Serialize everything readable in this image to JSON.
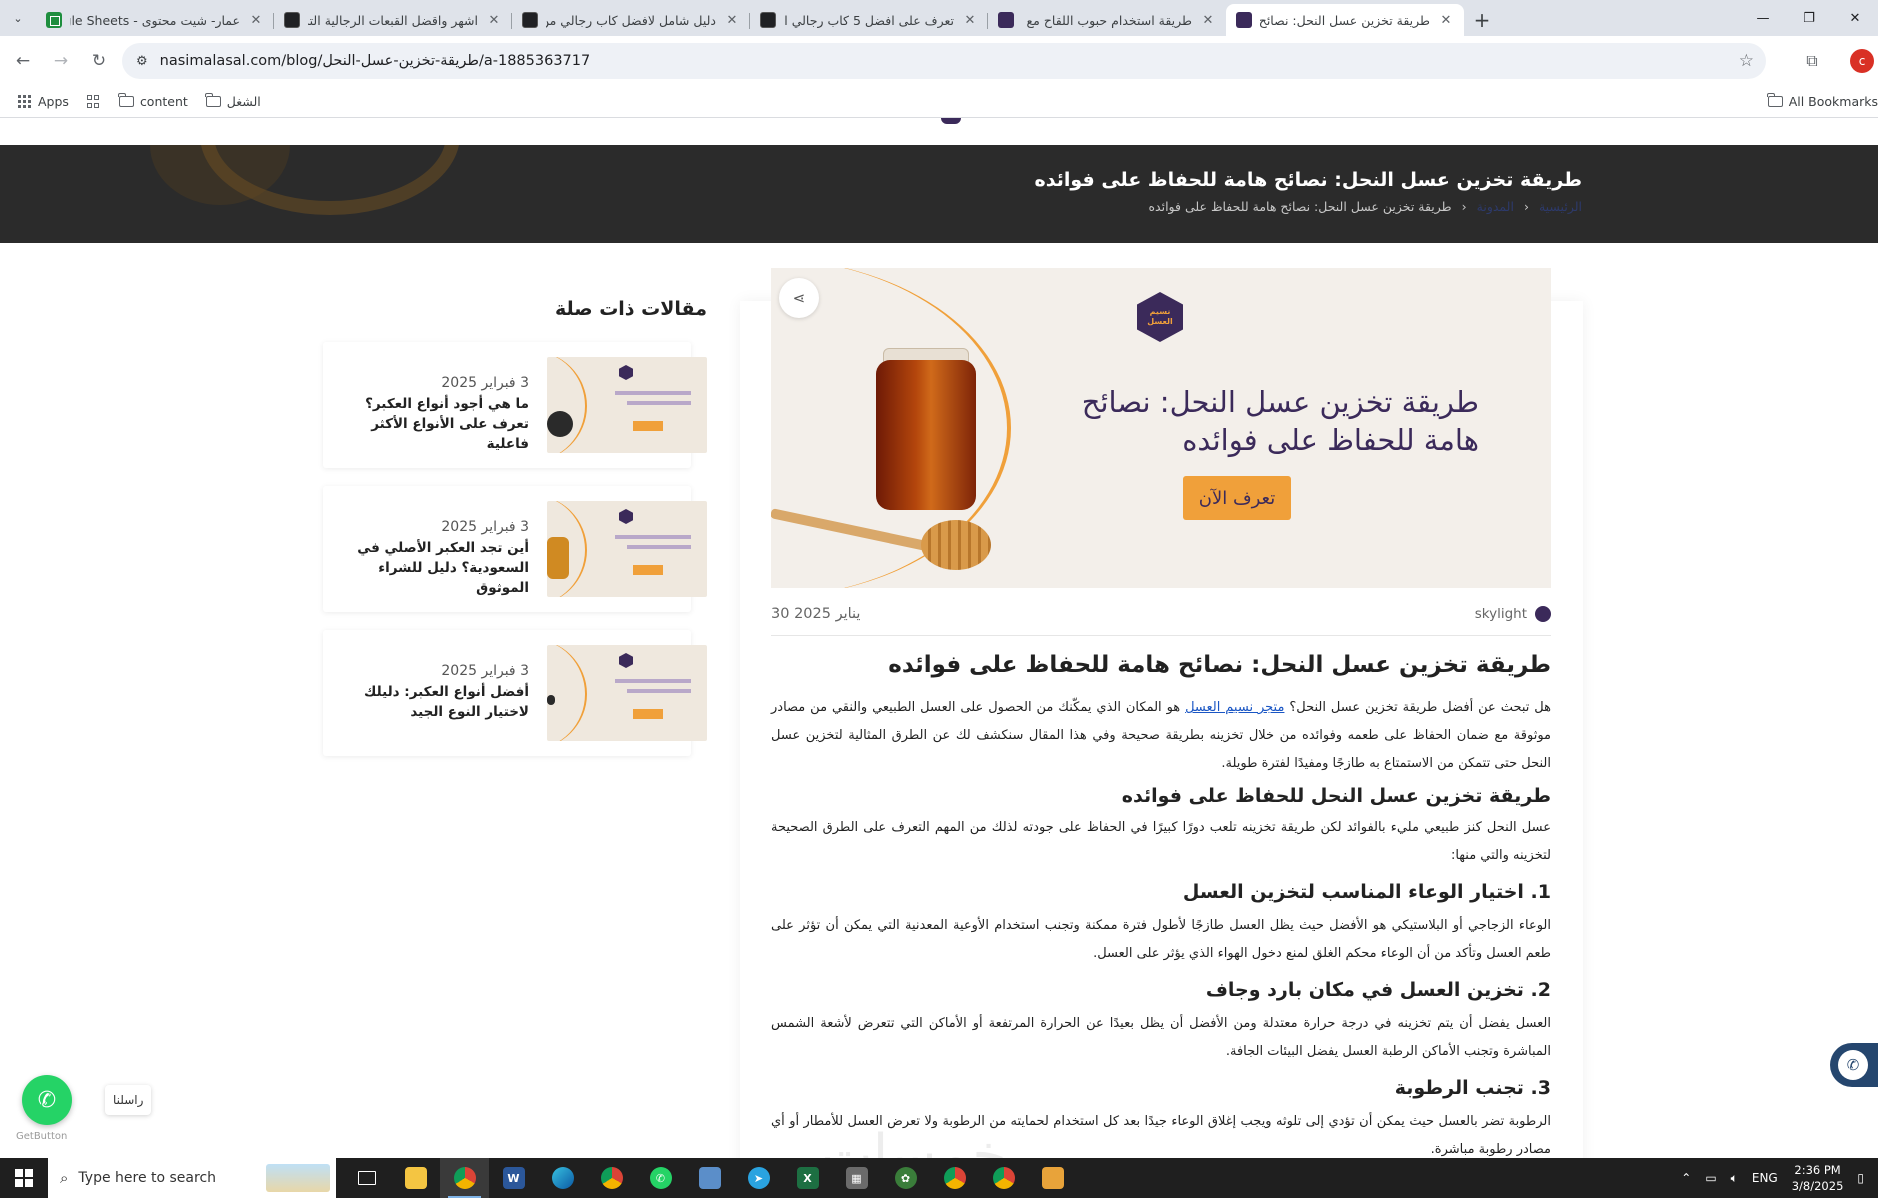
{
  "browser": {
    "tabs": [
      {
        "title": "عمار- شيت محتوى - Google Sheets",
        "favicon": "sheets"
      },
      {
        "title": "اشهر واقضل القبعات الرجالية التر",
        "favicon": "dark"
      },
      {
        "title": "دليل شامل لافضل كاب رجالي من",
        "favicon": "dark"
      },
      {
        "title": "تعرف على افضل 5 كاب رجالي اد",
        "favicon": "dark"
      },
      {
        "title": "طريقة استخدام حبوب اللقاح مع ا",
        "favicon": "brand"
      },
      {
        "title": "طريقة تخزين عسل النحل: نصائح ه",
        "favicon": "brand",
        "active": true
      }
    ],
    "new_tab_symbol": "+",
    "close_symbol": "✕",
    "url": "nasimalasal.com/blog/طريقة-تخزين-عسل-النحل/a-1885363717",
    "profile_initial": "c",
    "bookmarks": [
      {
        "label": "Apps",
        "icon": "apps-grid-icon"
      },
      {
        "label": "",
        "icon": "apps-icon"
      },
      {
        "label": "content",
        "icon": "folder-icon"
      },
      {
        "label": "الشغل",
        "icon": "folder-icon"
      }
    ],
    "all_bookmarks_label": "All Bookmarks"
  },
  "hero": {
    "title": "طريقة تخزين عسل النحل: نصائح هامة للحفاظ على فوائده",
    "breadcrumb": [
      "الرئيسية",
      "المدونة",
      "طريقة تخزين عسل النحل: نصائح هامة للحفاظ على فوائده"
    ]
  },
  "banner": {
    "brand_text": "نسيم العسل",
    "headline": "طريقة تخزين عسل النحل: نصائح هامة للحفاظ على فوائده",
    "cta_label": "تعرف الآن"
  },
  "article": {
    "date": "30 يناير 2025",
    "author": "skylight",
    "title": "طريقة تخزين عسل النحل: نصائح هامة للحفاظ على فوائده",
    "intro_before_link": "هل تبحث عن أفضل طريقة تخزين عسل النحل؟ ",
    "intro_link": "متجر نسيم العسل",
    "intro_after_link": " هو المكان الذي يمكّنك من الحصول على العسل الطبيعي والنقي من مصادر موثوقة مع ضمان الحفاظ على طعمه وفوائده من خلال تخزينه بطريقة صحيحة وفي هذا المقال سنكشف لك عن الطرق المثالية لتخزين عسل النحل حتى تتمكن من الاستمتاع به طازجًا ومفيدًا لفترة طويلة.",
    "h2": "طريقة تخزين عسل النحل للحفاظ على فوائده",
    "p2": "عسل النحل كنز طبيعي مليء بالفوائد لكن طريقة تخزينه تلعب دورًا كبيرًا في الحفاظ على جودته لذلك من المهم التعرف على الطرق الصحيحة لتخزينه والتي منها:",
    "s1_title": "1. اختيار الوعاء المناسب لتخزين العسل",
    "s1_text": "الوعاء الزجاجي أو البلاستيكي هو الأفضل حيث يظل العسل طازجًا لأطول فترة ممكنة وتجنب استخدام الأوعية المعدنية التي يمكن أن تؤثر على طعم العسل وتأكد من أن الوعاء محكم الغلق لمنع دخول الهواء الذي يؤثر على العسل.",
    "s2_title": "2. تخزين العسل في مكان بارد وجاف",
    "s2_text": "العسل يفضل أن يتم تخزينه في درجة حرارة معتدلة ومن الأفضل أن يظل بعيدًا عن الحرارة المرتفعة أو الأماكن التي تتعرض لأشعة الشمس المباشرة وتجنب الأماكن الرطبة العسل يفضل البيئات الجافة.",
    "s3_title": "3. تجنب الرطوبة",
    "s3_text": "الرطوبة تضر بالعسل حيث يمكن أن تؤدي إلى تلوثه ويجب إغلاق الوعاء جيدًا بعد كل استخدام لحمايته من الرطوبة ولا تعرض العسل للأمطار أو أي مصادر رطوبة مباشرة."
  },
  "related": {
    "heading": "مقالات ذات صلة",
    "items": [
      {
        "date": "3 فبراير 2025",
        "title": "ما هي أجود أنواع العكبر؟ تعرف على الأنواع الأكثر فاعلية"
      },
      {
        "date": "3 فبراير 2025",
        "title": "أين تجد العكبر الأصلي في السعودية؟ دليل للشراء الموثوق"
      },
      {
        "date": "3 فبراير 2025",
        "title": "أفضل أنواع العكبر: دليلك لاختيار النوع الجيد"
      }
    ]
  },
  "widgets": {
    "whatsapp_label": "راسلنا",
    "getbutton_label": "GetButton",
    "watermark": "خمسات"
  },
  "taskbar": {
    "search_placeholder": "Type here to search",
    "language": "ENG",
    "time": "2:36 PM",
    "date": "3/8/2025"
  },
  "colors": {
    "brand_purple": "#3b2a5a",
    "honey_orange": "#f0a03a",
    "whatsapp_green": "#25d366",
    "hero_dark": "#2b2b2b"
  }
}
